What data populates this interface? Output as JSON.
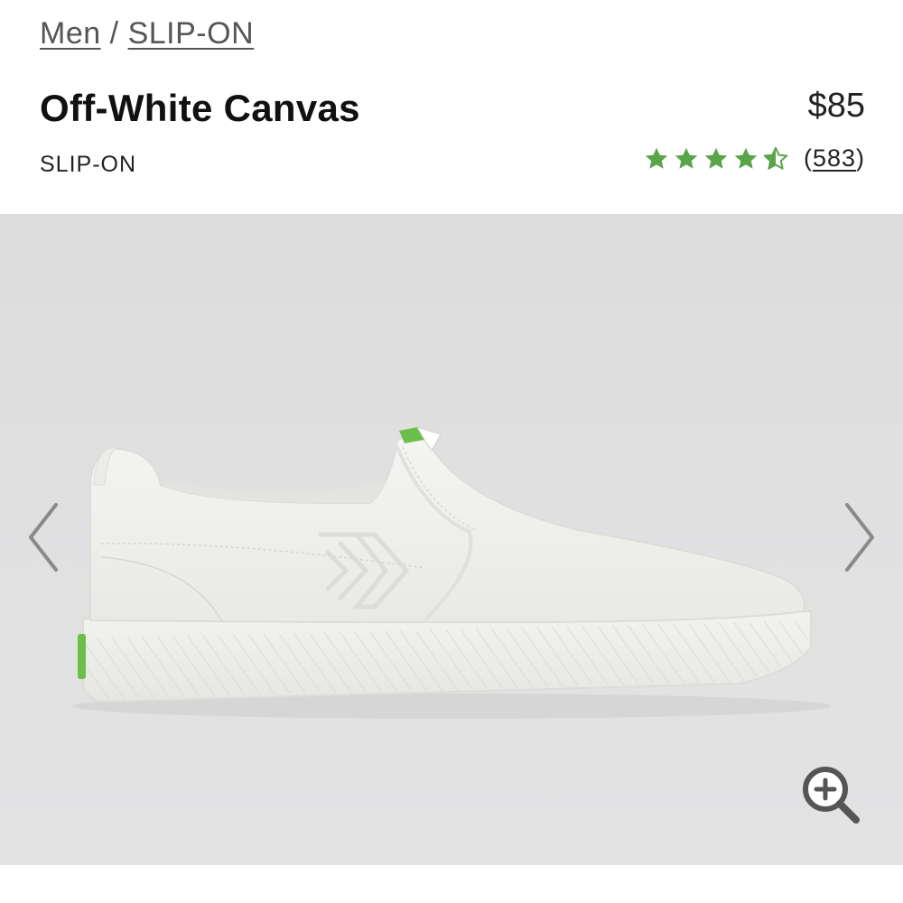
{
  "breadcrumb": {
    "items": [
      {
        "label": "Men"
      },
      {
        "label": "SLIP-ON"
      }
    ],
    "separator": "/"
  },
  "product": {
    "title": "Off-White Canvas",
    "price": "$85",
    "subtitle": "SLIP-ON",
    "rating": {
      "value": 4.5,
      "max": 5,
      "review_count_prefix": "(",
      "review_count": "583",
      "review_count_suffix": ")",
      "star_color": "#5aa54a"
    }
  },
  "gallery": {
    "image": "off-white-canvas-slip-on-shoe",
    "prev_icon": "chevron-left-icon",
    "next_icon": "chevron-right-icon",
    "zoom_icon": "zoom-in-icon"
  }
}
